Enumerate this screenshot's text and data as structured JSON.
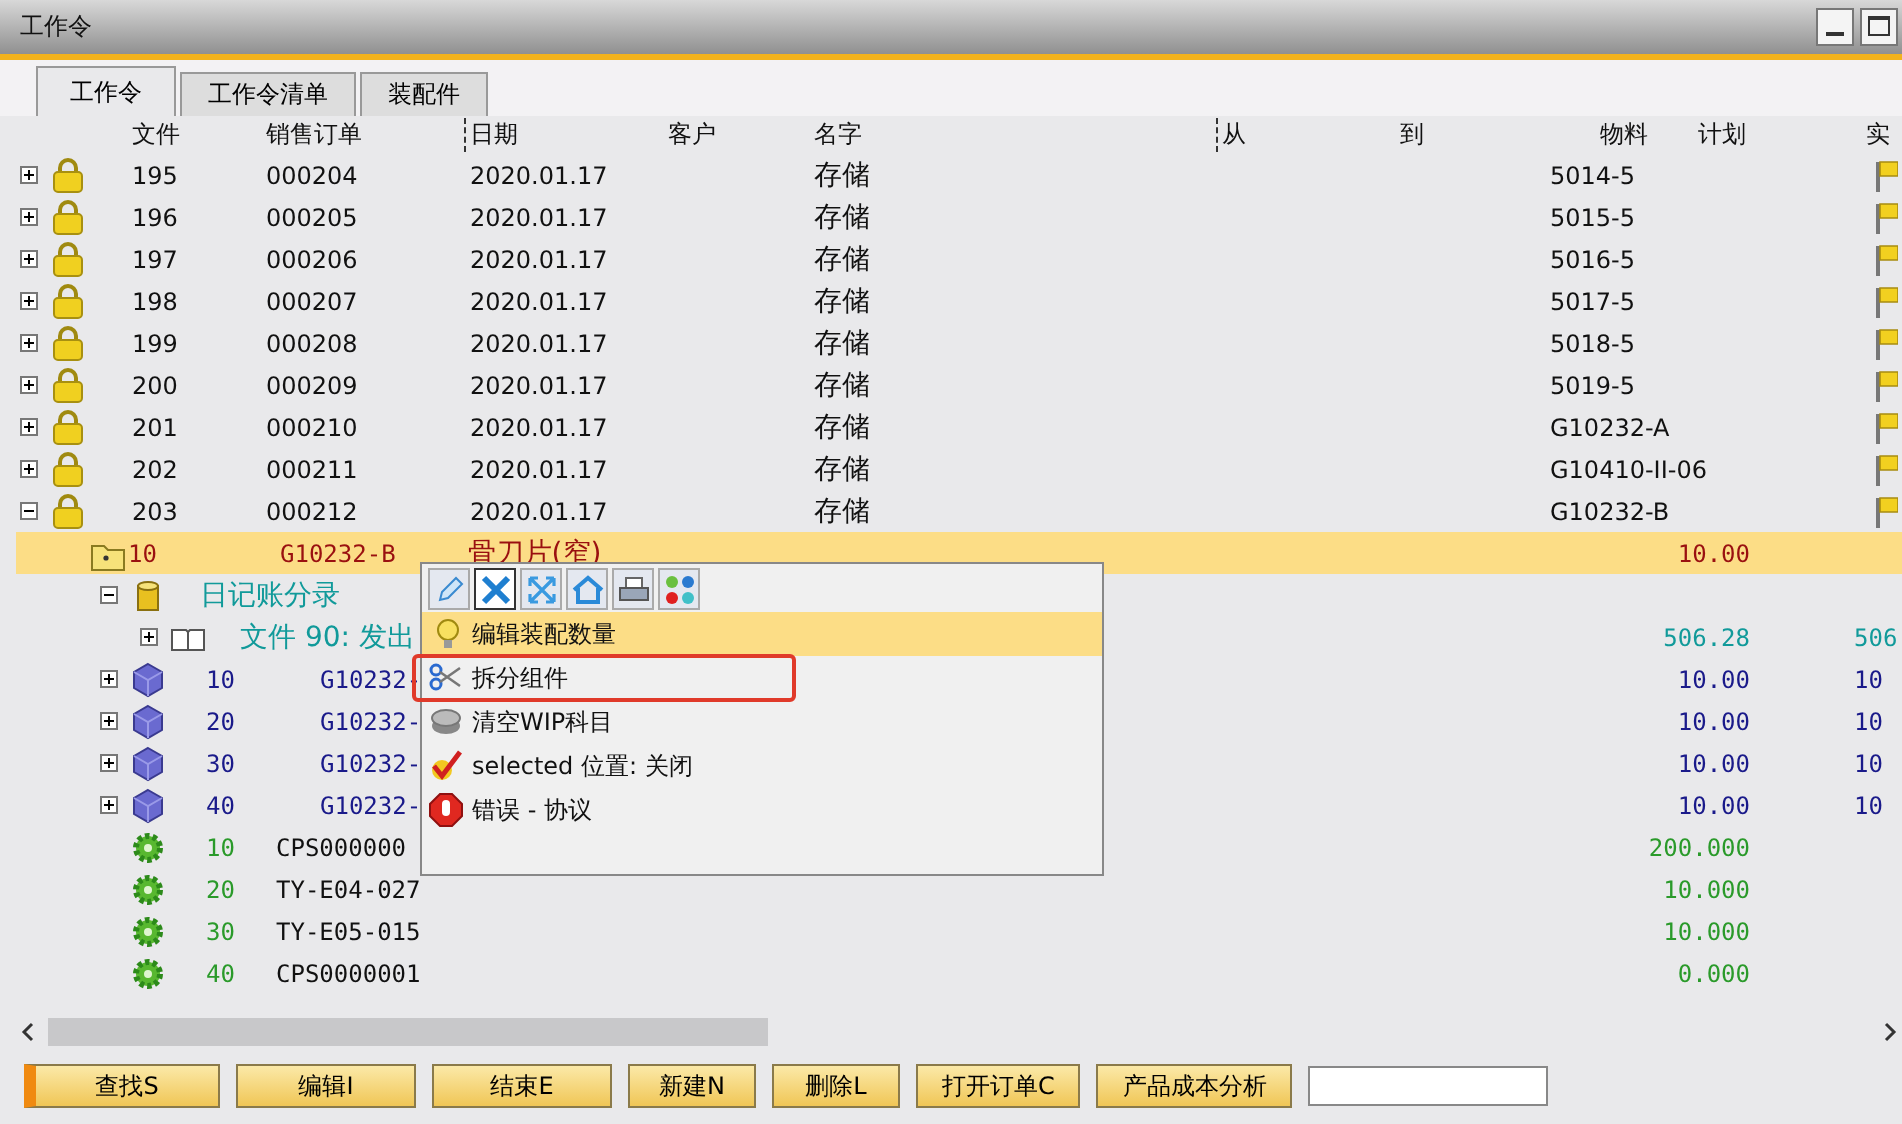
{
  "window": {
    "title": "工作令"
  },
  "tabs": [
    {
      "label": "工作令",
      "selected": true
    },
    {
      "label": "工作令清单",
      "selected": false
    },
    {
      "label": "装配件",
      "selected": false
    }
  ],
  "table": {
    "columns": [
      "文件",
      "销售订单",
      "日期",
      "客户",
      "名字",
      "从",
      "到",
      "物料",
      "计划",
      "实"
    ],
    "rows": [
      {
        "kind": "order",
        "document": "195",
        "sales_order": "000204",
        "date": "2020.01.17",
        "name": "存储",
        "material": "5014-5",
        "expanded": false,
        "selected": false
      },
      {
        "kind": "order",
        "document": "196",
        "sales_order": "000205",
        "date": "2020.01.17",
        "name": "存储",
        "material": "5015-5",
        "expanded": false,
        "selected": false
      },
      {
        "kind": "order",
        "document": "197",
        "sales_order": "000206",
        "date": "2020.01.17",
        "name": "存储",
        "material": "5016-5",
        "expanded": false,
        "selected": false
      },
      {
        "kind": "order",
        "document": "198",
        "sales_order": "000207",
        "date": "2020.01.17",
        "name": "存储",
        "material": "5017-5",
        "expanded": false,
        "selected": false
      },
      {
        "kind": "order",
        "document": "199",
        "sales_order": "000208",
        "date": "2020.01.17",
        "name": "存储",
        "material": "5018-5",
        "expanded": false,
        "selected": false
      },
      {
        "kind": "order",
        "document": "200",
        "sales_order": "000209",
        "date": "2020.01.17",
        "name": "存储",
        "material": "5019-5",
        "expanded": false,
        "selected": false
      },
      {
        "kind": "order",
        "document": "201",
        "sales_order": "000210",
        "date": "2020.01.17",
        "name": "存储",
        "material": "G10232-A",
        "expanded": false,
        "selected": false
      },
      {
        "kind": "order",
        "document": "202",
        "sales_order": "000211",
        "date": "2020.01.17",
        "name": "存储",
        "material": "G10410-II-06",
        "expanded": false,
        "selected": false
      },
      {
        "kind": "order",
        "document": "203",
        "sales_order": "000212",
        "date": "2020.01.17",
        "name": "存储",
        "material": "G10232-B",
        "expanded": true,
        "selected": false,
        "children": [
          {
            "kind": "assembly",
            "number": "10",
            "item": "G10232-B",
            "description": "骨刀片(窄)",
            "planned": "10.00",
            "selected": true,
            "children": [
              {
                "kind": "journal",
                "label": "日记账分录",
                "expanded": true,
                "selected": false,
                "children": [
                  {
                    "kind": "document",
                    "label": "文件 90: 发出",
                    "planned": "506.28",
                    "actual": "506",
                    "expanded": false,
                    "selected": false
                  }
                ]
              },
              {
                "kind": "component",
                "number": "10",
                "item": "G10232-",
                "planned": "10.00",
                "actual": "10",
                "expanded": false,
                "selected": false
              },
              {
                "kind": "component",
                "number": "20",
                "item": "G10232-",
                "planned": "10.00",
                "actual": "10",
                "expanded": false,
                "selected": false
              },
              {
                "kind": "component",
                "number": "30",
                "item": "G10232-",
                "planned": "10.00",
                "actual": "10",
                "expanded": false,
                "selected": false
              },
              {
                "kind": "component",
                "number": "40",
                "item": "G10232-",
                "planned": "10.00",
                "actual": "10",
                "expanded": false,
                "selected": false
              },
              {
                "kind": "resource",
                "number": "10",
                "item": "CPS000000",
                "planned": "200.000",
                "selected": false
              },
              {
                "kind": "resource",
                "number": "20",
                "item": "TY-E04-027",
                "planned": "10.000",
                "selected": false
              },
              {
                "kind": "resource",
                "number": "30",
                "item": "TY-E05-015",
                "planned": "10.000",
                "selected": false
              },
              {
                "kind": "resource",
                "number": "40",
                "item": "CPS0000001",
                "planned": "0.000",
                "selected": false
              }
            ]
          }
        ]
      }
    ]
  },
  "context_menu": {
    "toolbar": [
      {
        "kind": "pencil",
        "selected": false
      },
      {
        "kind": "tools",
        "selected": true
      },
      {
        "kind": "arrows",
        "selected": false
      },
      {
        "kind": "house",
        "selected": false
      },
      {
        "kind": "printer",
        "selected": false
      },
      {
        "kind": "dots",
        "selected": false
      }
    ],
    "items": [
      {
        "kind": "bulb",
        "label": "编辑装配数量",
        "selected": true,
        "marked": false
      },
      {
        "kind": "scissors",
        "label": "拆分组件",
        "selected": false,
        "marked": true
      },
      {
        "kind": "coins",
        "label": "清空WIP科目",
        "selected": false,
        "marked": false
      },
      {
        "kind": "check",
        "label": "selected 位置: 关闭",
        "selected": false,
        "marked": false
      },
      {
        "kind": "stop",
        "label": "错误 - 协议",
        "selected": false,
        "marked": false
      }
    ]
  },
  "buttons": [
    {
      "label": "查找S",
      "focused": true
    },
    {
      "label": "编辑I",
      "focused": false
    },
    {
      "label": "结束E",
      "focused": false
    },
    {
      "label": "新建N",
      "focused": false
    },
    {
      "label": "删除L",
      "focused": false
    },
    {
      "label": "打开订单C",
      "focused": false
    },
    {
      "label": "产品成本分析",
      "focused": false
    }
  ]
}
